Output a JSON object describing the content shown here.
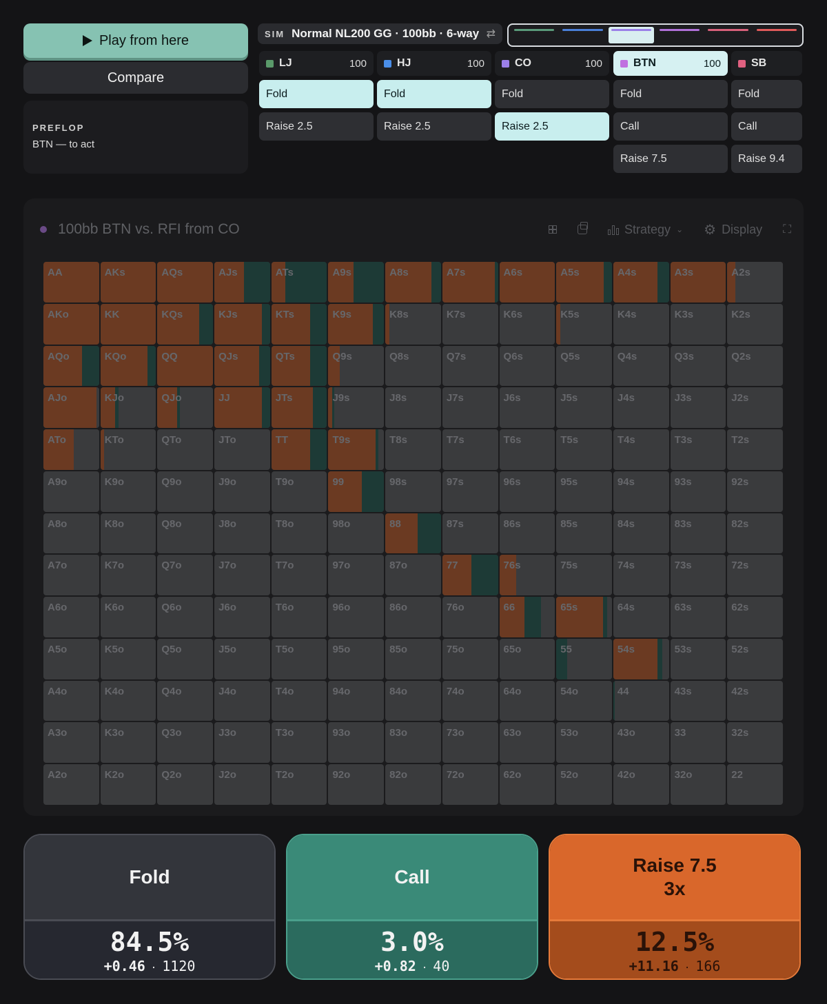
{
  "controls": {
    "play_label": "Play from here",
    "compare_label": "Compare"
  },
  "street": {
    "name": "PREFLOP",
    "to_act": "BTN — to act"
  },
  "sim": {
    "tag": "SIM",
    "title": "Normal NL200 GG · 100bb · 6-way",
    "swap_icon": "⇄"
  },
  "position_tabs": [
    {
      "color": "#5a9a7a",
      "active": false
    },
    {
      "color": "#4a7fd8",
      "active": false
    },
    {
      "color": "#9b7fe8",
      "active": true
    },
    {
      "color": "#b070d8",
      "active": false
    },
    {
      "color": "#d8607a",
      "active": false
    },
    {
      "color": "#e05a5a",
      "active": false
    }
  ],
  "players": [
    {
      "pos": "LJ",
      "stack": "100",
      "color": "#5a9a6a",
      "active": false,
      "actions": [
        {
          "label": "Fold",
          "selected": true
        },
        {
          "label": "Raise 2.5",
          "selected": false
        }
      ]
    },
    {
      "pos": "HJ",
      "stack": "100",
      "color": "#4a8ee8",
      "active": false,
      "actions": [
        {
          "label": "Fold",
          "selected": true
        },
        {
          "label": "Raise 2.5",
          "selected": false
        }
      ]
    },
    {
      "pos": "CO",
      "stack": "100",
      "color": "#9b7fe8",
      "active": false,
      "actions": [
        {
          "label": "Fold",
          "selected": false
        },
        {
          "label": "Raise 2.5",
          "selected": true
        }
      ]
    },
    {
      "pos": "BTN",
      "stack": "100",
      "color": "#c070e0",
      "active": true,
      "actions": [
        {
          "label": "Fold",
          "selected": false
        },
        {
          "label": "Call",
          "selected": false
        },
        {
          "label": "Raise 7.5",
          "selected": false
        }
      ]
    },
    {
      "pos": "SB",
      "stack": "",
      "color": "#e06080",
      "active": false,
      "actions": [
        {
          "label": "Fold",
          "selected": false
        },
        {
          "label": "Call",
          "selected": false
        },
        {
          "label": "Raise 9.4",
          "selected": false
        }
      ]
    }
  ],
  "panel": {
    "title": "100bb BTN vs. RFI from CO",
    "strategy_label": "Strategy",
    "display_label": "Display"
  },
  "colors": {
    "fold": "#3a3b3d",
    "call": "#1d3a36",
    "raise": "#6b3a22"
  },
  "hand_matrix": [
    [
      "AA",
      "AKs",
      "AQs",
      "AJs",
      "ATs",
      "A9s",
      "A8s",
      "A7s",
      "A6s",
      "A5s",
      "A4s",
      "A3s",
      "A2s"
    ],
    [
      "AKo",
      "KK",
      "KQs",
      "KJs",
      "KTs",
      "K9s",
      "K8s",
      "K7s",
      "K6s",
      "K5s",
      "K4s",
      "K3s",
      "K2s"
    ],
    [
      "AQo",
      "KQo",
      "QQ",
      "QJs",
      "QTs",
      "Q9s",
      "Q8s",
      "Q7s",
      "Q6s",
      "Q5s",
      "Q4s",
      "Q3s",
      "Q2s"
    ],
    [
      "AJo",
      "KJo",
      "QJo",
      "JJ",
      "JTs",
      "J9s",
      "J8s",
      "J7s",
      "J6s",
      "J5s",
      "J4s",
      "J3s",
      "J2s"
    ],
    [
      "ATo",
      "KTo",
      "QTo",
      "JTo",
      "TT",
      "T9s",
      "T8s",
      "T7s",
      "T6s",
      "T5s",
      "T4s",
      "T3s",
      "T2s"
    ],
    [
      "A9o",
      "K9o",
      "Q9o",
      "J9o",
      "T9o",
      "99",
      "98s",
      "97s",
      "96s",
      "95s",
      "94s",
      "93s",
      "92s"
    ],
    [
      "A8o",
      "K8o",
      "Q8o",
      "J8o",
      "T8o",
      "98o",
      "88",
      "87s",
      "86s",
      "85s",
      "84s",
      "83s",
      "82s"
    ],
    [
      "A7o",
      "K7o",
      "Q7o",
      "J7o",
      "T7o",
      "97o",
      "87o",
      "77",
      "76s",
      "75s",
      "74s",
      "73s",
      "72s"
    ],
    [
      "A6o",
      "K6o",
      "Q6o",
      "J6o",
      "T6o",
      "96o",
      "86o",
      "76o",
      "66",
      "65s",
      "64s",
      "63s",
      "62s"
    ],
    [
      "A5o",
      "K5o",
      "Q5o",
      "J5o",
      "T5o",
      "95o",
      "85o",
      "75o",
      "65o",
      "55",
      "54s",
      "53s",
      "52s"
    ],
    [
      "A4o",
      "K4o",
      "Q4o",
      "J4o",
      "T4o",
      "94o",
      "84o",
      "74o",
      "64o",
      "54o",
      "44",
      "43s",
      "42s"
    ],
    [
      "A3o",
      "K3o",
      "Q3o",
      "J3o",
      "T3o",
      "93o",
      "83o",
      "73o",
      "63o",
      "53o",
      "43o",
      "33",
      "32s"
    ],
    [
      "A2o",
      "K2o",
      "Q2o",
      "J2o",
      "T2o",
      "92o",
      "82o",
      "72o",
      "62o",
      "52o",
      "42o",
      "32o",
      "22"
    ]
  ],
  "hand_strategy": {
    "AA": [
      0,
      0,
      1
    ],
    "AKs": [
      0,
      0,
      1
    ],
    "AQs": [
      0,
      0,
      1
    ],
    "AJs": [
      0,
      0.47,
      0.53
    ],
    "ATs": [
      0,
      0.75,
      0.25
    ],
    "A9s": [
      0,
      0.55,
      0.45
    ],
    "A8s": [
      0,
      0.17,
      0.83
    ],
    "A7s": [
      0,
      0.05,
      0.95
    ],
    "A6s": [
      0,
      0,
      1
    ],
    "A5s": [
      0,
      0.15,
      0.85
    ],
    "A4s": [
      0,
      0.2,
      0.8
    ],
    "A3s": [
      0,
      0,
      1
    ],
    "A2s": [
      0.85,
      0,
      0.15
    ],
    "AKo": [
      0,
      0,
      1
    ],
    "KK": [
      0,
      0,
      1
    ],
    "KQs": [
      0,
      0.25,
      0.75
    ],
    "KJs": [
      0,
      0.15,
      0.85
    ],
    "KTs": [
      0,
      0.3,
      0.7
    ],
    "K9s": [
      0,
      0.2,
      0.8
    ],
    "K8s": [
      0.93,
      0,
      0.07
    ],
    "K5s": [
      0.93,
      0,
      0.07
    ],
    "AQo": [
      0,
      0.3,
      0.7
    ],
    "KQo": [
      0,
      0.15,
      0.85
    ],
    "QQ": [
      0,
      0,
      1
    ],
    "QJs": [
      0,
      0.2,
      0.8
    ],
    "QTs": [
      0,
      0.3,
      0.7
    ],
    "Q9s": [
      0.8,
      0,
      0.2
    ],
    "AJo": [
      0.05,
      0,
      0.95
    ],
    "KJo": [
      0.68,
      0.05,
      0.27
    ],
    "QJo": [
      0.6,
      0.04,
      0.36
    ],
    "JJ": [
      0,
      0.15,
      0.85
    ],
    "JTs": [
      0,
      0.25,
      0.75
    ],
    "J9s": [
      0.9,
      0.03,
      0.07
    ],
    "ATo": [
      0.45,
      0,
      0.55
    ],
    "KTo": [
      0.93,
      0,
      0.07
    ],
    "TT": [
      0,
      0.3,
      0.7
    ],
    "T9s": [
      0.1,
      0.05,
      0.85
    ],
    "99": [
      0,
      0.4,
      0.6
    ],
    "88": [
      0,
      0.42,
      0.58
    ],
    "77": [
      0,
      0.48,
      0.52
    ],
    "76s": [
      0.7,
      0,
      0.3
    ],
    "66": [
      0.25,
      0.3,
      0.45
    ],
    "65s": [
      0.08,
      0.08,
      0.84
    ],
    "55": [
      0.8,
      0.2,
      0
    ],
    "54s": [
      0.12,
      0.08,
      0.8
    ],
    "44": [
      0.98,
      0.02,
      0
    ]
  },
  "summary": [
    {
      "action": "Fold",
      "line2": "",
      "pct": "84.5%",
      "ev": "+0.46",
      "combos": "1120",
      "top_bg": "#33353b",
      "bot_bg": "#262830",
      "border": "#4a4c54",
      "color": "#f2f2f2"
    },
    {
      "action": "Call",
      "line2": "",
      "pct": "3.0%",
      "ev": "+0.82",
      "combos": "40",
      "top_bg": "#3a8a78",
      "bot_bg": "#2b6b5e",
      "border": "#4aa08c",
      "color": "#f2f2f2"
    },
    {
      "action": "Raise 7.5",
      "line2": "3x",
      "pct": "12.5%",
      "ev": "+11.16",
      "combos": "166",
      "top_bg": "#d9672b",
      "bot_bg": "#a44c1c",
      "border": "#e67a3a",
      "color": "#2a1208"
    }
  ]
}
